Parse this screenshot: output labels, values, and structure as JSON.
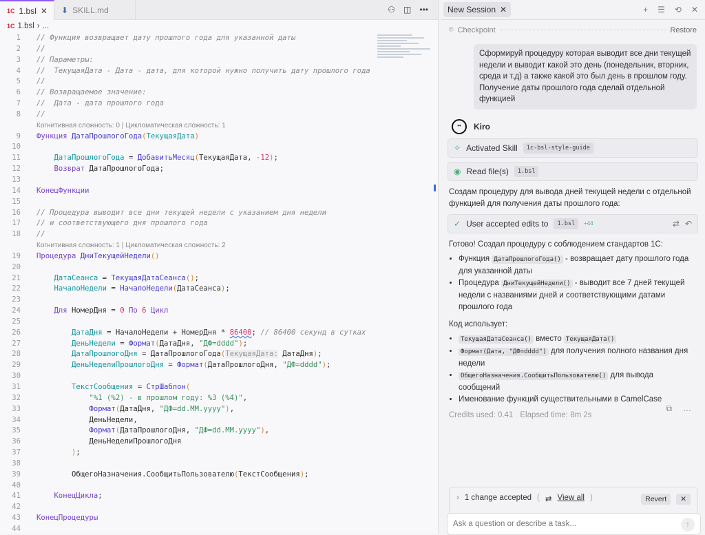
{
  "editor": {
    "tabs": [
      {
        "label": "1.bsl",
        "icon": "1c"
      },
      {
        "label": "SKILL.md",
        "icon": "markdown"
      }
    ],
    "breadcrumb": {
      "file": "1.bsl",
      "more": "..."
    },
    "lens": [
      "Когнитивная сложность: 0 | Цикломатическая сложность: 1",
      "Когнитивная сложность: 1 | Цикломатическая сложность: 2"
    ],
    "lines": [
      [
        [
          "cm",
          "// Функция возвращает дату прошлого года для указанной даты"
        ]
      ],
      [
        [
          "cm",
          "//"
        ]
      ],
      [
        [
          "cm",
          "// Параметры:"
        ]
      ],
      [
        [
          "cm",
          "//  ТекущаяДата - Дата - дата, для которой нужно получить дату прошлого года"
        ]
      ],
      [
        [
          "cm",
          "//"
        ]
      ],
      [
        [
          "cm",
          "// Возвращаемое значение:"
        ]
      ],
      [
        [
          "cm",
          "//  Дата - дата прошлого года"
        ]
      ],
      [
        [
          "cm",
          "//"
        ]
      ],
      [
        [
          "kw",
          "Функция "
        ],
        [
          "fn",
          "ДатаПрошлогоГода"
        ],
        [
          "pr",
          "("
        ],
        [
          "vr",
          "ТекущаяДата"
        ],
        [
          "pr",
          ")"
        ]
      ],
      [],
      [
        [
          "tx2",
          "    "
        ],
        [
          "vr",
          "ДатаПрошлогоГода"
        ],
        [
          "tx2",
          " = "
        ],
        [
          "fn",
          "ДобавитьМесяц"
        ],
        [
          "pr",
          "("
        ],
        [
          "tx2",
          "ТекущаяДата, "
        ],
        [
          "nm",
          "-12"
        ],
        [
          "pr",
          ")"
        ],
        [
          "tx2",
          ";"
        ]
      ],
      [
        [
          "tx2",
          "    "
        ],
        [
          "kw",
          "Возврат "
        ],
        [
          "tx2",
          "ДатаПрошлогоГода;"
        ]
      ],
      [],
      [
        [
          "kw",
          "КонецФункции"
        ]
      ],
      [],
      [
        [
          "cm",
          "// Процедура выводит все дни текущей недели с указанием дня недели"
        ]
      ],
      [
        [
          "cm",
          "// и соответствующего дня прошлого года"
        ]
      ],
      [
        [
          "cm",
          "//"
        ]
      ],
      [
        [
          "kw",
          "Процедура "
        ],
        [
          "fn",
          "ДниТекущейНедели"
        ],
        [
          "pr",
          "()"
        ]
      ],
      [],
      [
        [
          "tx2",
          "    "
        ],
        [
          "vr",
          "ДатаСеанса"
        ],
        [
          "tx2",
          " = "
        ],
        [
          "fn",
          "ТекущаяДатаСеанса"
        ],
        [
          "pr",
          "()"
        ],
        [
          "tx2",
          ";"
        ]
      ],
      [
        [
          "tx2",
          "    "
        ],
        [
          "vr",
          "НачалоНедели"
        ],
        [
          "tx2",
          " = "
        ],
        [
          "fn",
          "НачалоНедели"
        ],
        [
          "pr",
          "("
        ],
        [
          "tx2",
          "ДатаСеанса"
        ],
        [
          "pr",
          ")"
        ],
        [
          "tx2",
          ";"
        ]
      ],
      [],
      [
        [
          "tx2",
          "    "
        ],
        [
          "kw",
          "Для "
        ],
        [
          "tx2",
          "НомерДня = "
        ],
        [
          "nm",
          "0"
        ],
        [
          "kw",
          " По "
        ],
        [
          "nm",
          "6"
        ],
        [
          "kw",
          " Цикл"
        ]
      ],
      [],
      [
        [
          "tx2",
          "        "
        ],
        [
          "vr",
          "ДатаДня"
        ],
        [
          "tx2",
          " = НачалоНедели + НомерДня * "
        ],
        [
          "nm sq",
          "86400"
        ],
        [
          "tx2",
          "; "
        ],
        [
          "cm",
          "// 86400 секунд в сутках"
        ]
      ],
      [
        [
          "tx2",
          "        "
        ],
        [
          "vr",
          "ДеньНедели"
        ],
        [
          "tx2",
          " = "
        ],
        [
          "fn",
          "Формат"
        ],
        [
          "pr",
          "("
        ],
        [
          "tx2",
          "ДатаДня, "
        ],
        [
          "st",
          "\"ДФ=dddd\""
        ],
        [
          "pr",
          ")"
        ],
        [
          "tx2",
          ";"
        ]
      ],
      [
        [
          "tx2",
          "        "
        ],
        [
          "vr",
          "ДатаПрошлогоДня"
        ],
        [
          "tx2",
          " = ДатаПрошлогоГода"
        ],
        [
          "pr",
          "("
        ],
        [
          "hint",
          "ТекущаяДата:"
        ],
        [
          "tx2",
          " ДатаДня"
        ],
        [
          "pr",
          ")"
        ],
        [
          "tx2",
          ";"
        ]
      ],
      [
        [
          "tx2",
          "        "
        ],
        [
          "vr",
          "ДеньНеделиПрошлогоДня"
        ],
        [
          "tx2",
          " = "
        ],
        [
          "fn",
          "Формат"
        ],
        [
          "pr",
          "("
        ],
        [
          "tx2",
          "ДатаПрошлогоДня, "
        ],
        [
          "st",
          "\"ДФ=dddd\""
        ],
        [
          "pr",
          ")"
        ],
        [
          "tx2",
          ";"
        ]
      ],
      [],
      [
        [
          "tx2",
          "        "
        ],
        [
          "vr",
          "ТекстСообщения"
        ],
        [
          "tx2",
          " = "
        ],
        [
          "fn",
          "СтрШаблон"
        ],
        [
          "pr",
          "("
        ]
      ],
      [
        [
          "tx2",
          "            "
        ],
        [
          "st",
          "\"%1 (%2) - в прошлом году: %3 (%4)\""
        ],
        [
          "tx2",
          ","
        ]
      ],
      [
        [
          "tx2",
          "            "
        ],
        [
          "fn",
          "Формат"
        ],
        [
          "pr",
          "("
        ],
        [
          "tx2",
          "ДатаДня, "
        ],
        [
          "st",
          "\"ДФ=dd.MM.yyyy\""
        ],
        [
          "pr",
          ")"
        ],
        [
          "tx2",
          ","
        ]
      ],
      [
        [
          "tx2",
          "            ДеньНедели,"
        ]
      ],
      [
        [
          "tx2",
          "            "
        ],
        [
          "fn",
          "Формат"
        ],
        [
          "pr",
          "("
        ],
        [
          "tx2",
          "ДатаПрошлогоДня, "
        ],
        [
          "st",
          "\"ДФ=dd.MM.yyyy\""
        ],
        [
          "pr",
          ")"
        ],
        [
          "tx2",
          ","
        ]
      ],
      [
        [
          "tx2",
          "            ДеньНеделиПрошлогоДня"
        ]
      ],
      [
        [
          "tx2",
          "        "
        ],
        [
          "pr",
          ")"
        ],
        [
          "tx2",
          ";"
        ]
      ],
      [],
      [
        [
          "tx2",
          "        ОбщегоНазначения.СообщитьПользователю"
        ],
        [
          "pr",
          "("
        ],
        [
          "tx2",
          "ТекстСообщения"
        ],
        [
          "pr",
          ")"
        ],
        [
          "tx2",
          ";"
        ]
      ],
      [],
      [
        [
          "tx2",
          "    "
        ],
        [
          "kw",
          "КонецЦикла"
        ],
        [
          "tx2",
          ";"
        ]
      ],
      [],
      [
        [
          "kw",
          "КонецПроцедуры"
        ]
      ],
      []
    ]
  },
  "panel": {
    "tab_label": "New Session",
    "checkpoint": "Checkpoint",
    "restore": "Restore",
    "user_message": "Сформируй процедуру которая выводит все дни текущей недели и выводит какой это день (понедельник, вторник, среда и т.д) а также какой это был день в прошлом году. Получение даты прошлого года сделай отдельной функцией",
    "agent_name": "Kiro",
    "activated_skill": "Activated Skill",
    "skill_name": "1c-bsl-style-guide",
    "read_files": "Read file(s)",
    "read_file_name": "1.bsl",
    "intro": "Создам процедуру для вывода дней текущей недели с отдельной функцией для получения даты прошлого года:",
    "accepted": "User accepted edits to",
    "accepted_file": "1.bsl",
    "accepted_diff": "+44",
    "done": "Готово! Создал процедуру с соблюдением стандартов 1С:",
    "bullets1": [
      {
        "pre": "Функция ",
        "code": "ДатаПрошлогоГода()",
        "post": " - возвращает дату прошлого года для указанной даты"
      },
      {
        "pre": "Процедура ",
        "code": "ДниТекущейНедели()",
        "post": " - выводит все 7 дней текущей недели с названиями дней и соответствующими датами прошлого года"
      }
    ],
    "uses": "Код использует:",
    "bullets2": [
      {
        "code": "ТекущаяДатаСеанса()",
        "mid": " вместо ",
        "code2": "ТекущаяДата()",
        "post": ""
      },
      {
        "code": "Формат(Дата, \"ДФ=dddd\")",
        "post": " для получения полного названия дня недели"
      },
      {
        "code": "ОбщегоНазначения.СообщитьПользователю()",
        "post": " для вывода сообщений"
      },
      {
        "post": "Именование функций существительными в CamelCase"
      }
    ],
    "credits": "Credits used: 0.41",
    "elapsed": "Elapsed time: 8m 2s",
    "changes": "1 change accepted",
    "view_all": "View all",
    "revert": "Revert",
    "input_placeholder": "Ask a question or describe a task..."
  }
}
